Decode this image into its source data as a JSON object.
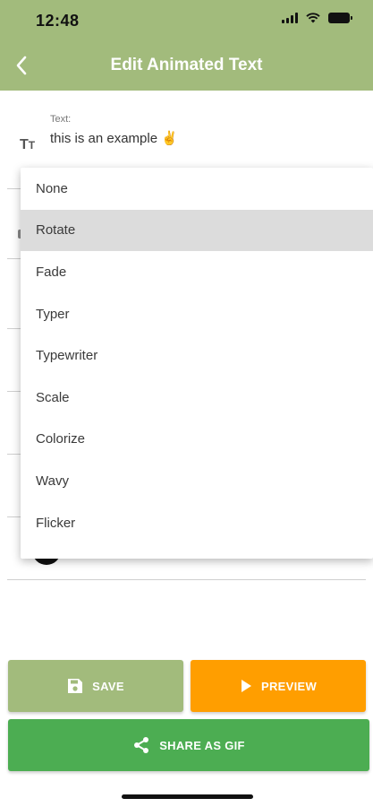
{
  "status_bar": {
    "time": "12:48"
  },
  "header": {
    "title": "Edit Animated Text"
  },
  "text_field": {
    "label": "Text:",
    "value": "this is an example ✌️",
    "icon": "text-format-icon"
  },
  "dropdown": {
    "options": [
      "None",
      "Rotate",
      "Fade",
      "Typer",
      "Typewriter",
      "Scale",
      "Colorize",
      "Wavy",
      "Flicker"
    ],
    "selected": "Rotate"
  },
  "buttons": {
    "save": "SAVE",
    "preview": "PREVIEW",
    "share": "SHARE AS GIF"
  },
  "colors": {
    "header": "#a2bb7c",
    "save": "#a2bb7c",
    "preview": "#ff9e00",
    "share": "#4cad52",
    "selected_option": "#dcdcdc"
  }
}
